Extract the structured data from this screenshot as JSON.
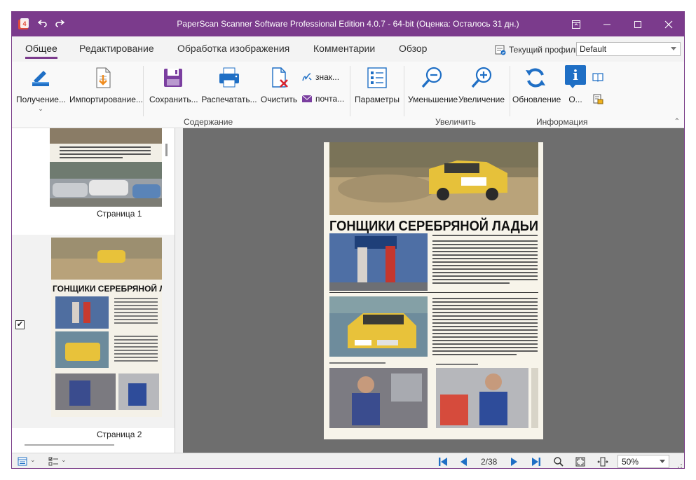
{
  "titlebar": {
    "title": "PaperScan Scanner Software Professional Edition 4.0.7 - 64-bit (Оценка: Осталось 31 дн.)",
    "app_badge": "4"
  },
  "tabs": [
    {
      "label": "Общее",
      "active": true
    },
    {
      "label": "Редактирование",
      "active": false
    },
    {
      "label": "Обработка изображения",
      "active": false
    },
    {
      "label": "Комментарии",
      "active": false
    },
    {
      "label": "Обзор",
      "active": false
    }
  ],
  "profile": {
    "label": "Текущий профиль",
    "value": "Default"
  },
  "ribbon": {
    "acquire": "Получение...",
    "import": "Импортирование...",
    "save": "Сохранить...",
    "print": "Распечатать...",
    "clear": "Очистить",
    "sign": "знак...",
    "mail": "почта...",
    "params": "Параметры",
    "zoom_out": "Уменьшение",
    "zoom_in": "Увеличение",
    "refresh": "Обновление",
    "about": "О...",
    "group_content": "Содержание",
    "group_zoom": "Увеличить",
    "group_info": "Информация",
    "about_badge": "i"
  },
  "thumbs": {
    "page1": "Страница 1",
    "page2": "Страница 2",
    "checked": "✔"
  },
  "document": {
    "headline": "ГОНЩИКИ СЕРЕБРЯНОЙ ЛАДЬИ"
  },
  "status": {
    "page": "2/38",
    "zoom": "50%"
  },
  "colors": {
    "accent": "#7b3b8c",
    "ribbon_blue": "#1f6fc5",
    "save_purple": "#7b3fa0",
    "viewer_bg": "#6e6e6e"
  }
}
